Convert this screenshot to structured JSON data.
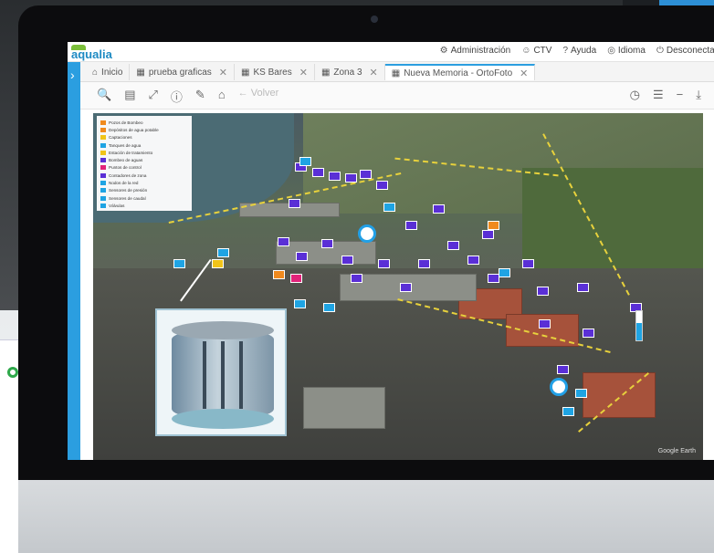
{
  "app": {
    "logo": "aqualia"
  },
  "header_menu": [
    {
      "label": "Administración",
      "icon": "gear-icon"
    },
    {
      "label": "CTV",
      "icon": "user-icon"
    },
    {
      "label": "Ayuda",
      "icon": "help-icon"
    },
    {
      "label": "Idioma",
      "icon": "globe-icon"
    },
    {
      "label": "Desconectar",
      "icon": "power-icon"
    }
  ],
  "tabs": [
    {
      "label": "Inicio",
      "icon": "home-icon",
      "closable": false
    },
    {
      "label": "prueba graficas",
      "icon": "grid-icon",
      "closable": true
    },
    {
      "label": "KS Bares",
      "icon": "grid-icon",
      "closable": true
    },
    {
      "label": "Zona 3",
      "icon": "grid-icon",
      "closable": true
    },
    {
      "label": "Nueva Memoria - OrtoFoto",
      "icon": "grid-icon",
      "closable": true,
      "active": true
    }
  ],
  "toolbar": {
    "left_tools": [
      "zoom-icon",
      "layers-icon",
      "fullscreen-icon",
      "info-icon",
      "edit-icon",
      "home-icon"
    ],
    "back_label": "Volver",
    "right_tools": [
      "clock-icon",
      "list-icon",
      "minus-icon",
      "download-icon"
    ]
  },
  "legend": [
    {
      "label": "Pozos de Bombeo",
      "color": "#f08a1e"
    },
    {
      "label": "Depósitos de agua potable",
      "color": "#f08a1e"
    },
    {
      "label": "Captaciones",
      "color": "#f0c419"
    },
    {
      "label": "Tanques de agua",
      "color": "#1fa4e3"
    },
    {
      "label": "Estación de tratamiento",
      "color": "#f0c419"
    },
    {
      "label": "Bombeo de aguas",
      "color": "#5a2fd6"
    },
    {
      "label": "Puntos de control",
      "color": "#e2237a"
    },
    {
      "label": "Contadores de zona",
      "color": "#5a2fd6"
    },
    {
      "label": "Nodos de la red",
      "color": "#1fa4e3"
    },
    {
      "label": "Sensores de presión",
      "color": "#1fa4e3"
    },
    {
      "label": "Sensores de caudal",
      "color": "#1fa4e3"
    },
    {
      "label": "Válvulas",
      "color": "#1fa4e3"
    }
  ],
  "map": {
    "gauge_level": 0.6,
    "nav_label": "Google Earth"
  }
}
